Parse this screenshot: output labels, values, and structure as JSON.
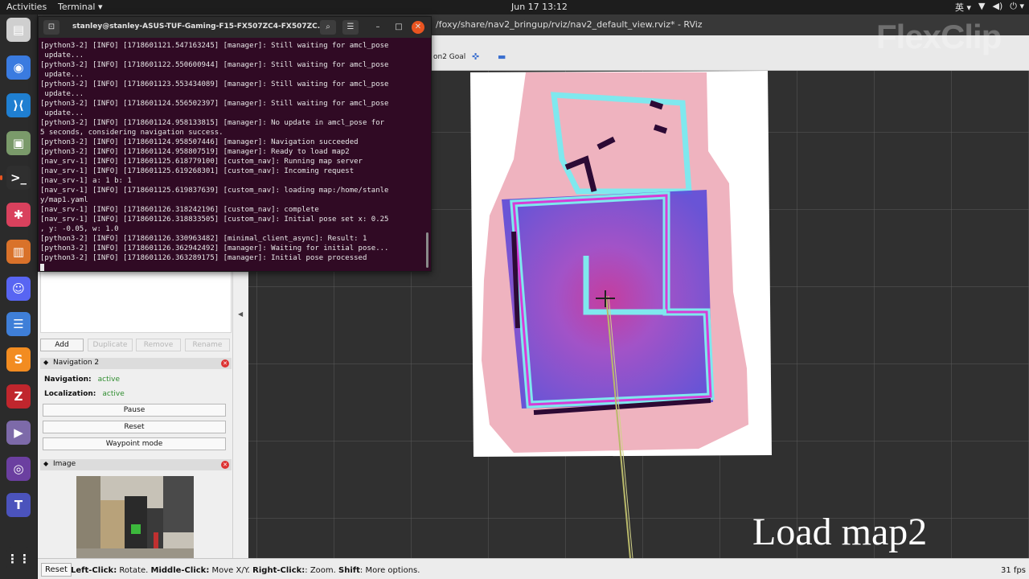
{
  "topbar": {
    "activities": "Activities",
    "app": "Terminal ▾",
    "clock": "Jun 17  13:12",
    "tray": [
      "英 ▾",
      "▼",
      "◀)",
      "⏻ ▾"
    ]
  },
  "dock": {
    "icons": [
      {
        "name": "files",
        "glyph": "▤",
        "color": "#cfcfcf"
      },
      {
        "name": "chrome",
        "glyph": "◉",
        "color": "#3a7be0"
      },
      {
        "name": "vscode",
        "glyph": "⟩⟨",
        "color": "#1f7fd1"
      },
      {
        "name": "installer",
        "glyph": "▣",
        "color": "#7a9a6a"
      },
      {
        "name": "terminal",
        "glyph": ">_",
        "color": "#2f2f2f"
      },
      {
        "name": "slack",
        "glyph": "✱",
        "color": "#d9415d"
      },
      {
        "name": "presentation",
        "glyph": "▥",
        "color": "#d9722a"
      },
      {
        "name": "discord",
        "glyph": "☺",
        "color": "#5865f2"
      },
      {
        "name": "text-editor",
        "glyph": "☰",
        "color": "#3f7fd8"
      },
      {
        "name": "sublime",
        "glyph": "S",
        "color": "#f28c21"
      },
      {
        "name": "filezilla",
        "glyph": "Z",
        "color": "#c0262d"
      },
      {
        "name": "video",
        "glyph": "▶",
        "color": "#7d6aa9"
      },
      {
        "name": "github",
        "glyph": "◎",
        "color": "#6b3fa0"
      },
      {
        "name": "teams",
        "glyph": "T",
        "color": "#4b53bc"
      },
      {
        "name": "apps-grid",
        "glyph": "⋮⋮",
        "color": "#2b2b2b"
      }
    ]
  },
  "rviz": {
    "title": "/foxy/share/nav2_bringup/rviz/nav2_default_view.rviz* - RViz",
    "toolbar_goal": "on2 Goal",
    "panels": {
      "buttons": [
        "Add",
        "Duplicate",
        "Remove",
        "Rename"
      ],
      "nav_panel_title": "Navigation 2",
      "navigation_label": "Navigation:",
      "navigation_value": "active",
      "localization_label": "Localization:",
      "localization_value": "active",
      "pause": "Pause",
      "reset": "Reset",
      "waypoint": "Waypoint mode",
      "image_panel_title": "Image"
    },
    "status": {
      "reset": "Reset",
      "hint_left": "Left-Click:",
      "hint_left_t": " Rotate. ",
      "hint_mid": "Middle-Click:",
      "hint_mid_t": " Move X/Y. ",
      "hint_right": "Right-Click:",
      "hint_right_t": ": Zoom. ",
      "hint_shift": "Shift",
      "hint_shift_t": ": More options.",
      "fps": "31 fps"
    }
  },
  "terminal": {
    "title": "stanley@stanley-ASUS-TUF-Gaming-F15-FX507ZC4-FX507ZC...",
    "lines": [
      "[python3-2] [INFO] [1718601121.547163245] [manager]: Still waiting for amcl_pose",
      " update...",
      "[python3-2] [INFO] [1718601122.550600944] [manager]: Still waiting for amcl_pose",
      " update...",
      "[python3-2] [INFO] [1718601123.553434089] [manager]: Still waiting for amcl_pose",
      " update...",
      "[python3-2] [INFO] [1718601124.556502397] [manager]: Still waiting for amcl_pose",
      " update...",
      "[python3-2] [INFO] [1718601124.958133815] [manager]: No update in amcl_pose for",
      "5 seconds, considering navigation success.",
      "[python3-2] [INFO] [1718601124.958507446] [manager]: Navigation succeeded",
      "[python3-2] [INFO] [1718601124.958807519] [manager]: Ready to load map2",
      "[nav_srv-1] [INFO] [1718601125.618779100] [custom_nav]: Running map server",
      "[nav_srv-1] [INFO] [1718601125.619268301] [custom_nav]: Incoming request",
      "[nav_srv-1] a: 1 b: 1",
      "[nav_srv-1] [INFO] [1718601125.619837639] [custom_nav]: loading map:/home/stanle",
      "y/map1.yaml",
      "[nav_srv-1] [INFO] [1718601126.318242196] [custom_nav]: complete",
      "[nav_srv-1] [INFO] [1718601126.318833505] [custom_nav]: Initial pose set x: 0.25",
      ", y: -0.05, w: 1.0",
      "[python3-2] [INFO] [1718601126.330963482] [minimal_client_async]: Result: 1",
      "[python3-2] [INFO] [1718601126.362942492] [manager]: Waiting for initial pose...",
      "[python3-2] [INFO] [1718601126.363289175] [manager]: Initial pose processed"
    ]
  },
  "overlay": {
    "watermark": "FlexClip",
    "caption": "Load map2"
  }
}
